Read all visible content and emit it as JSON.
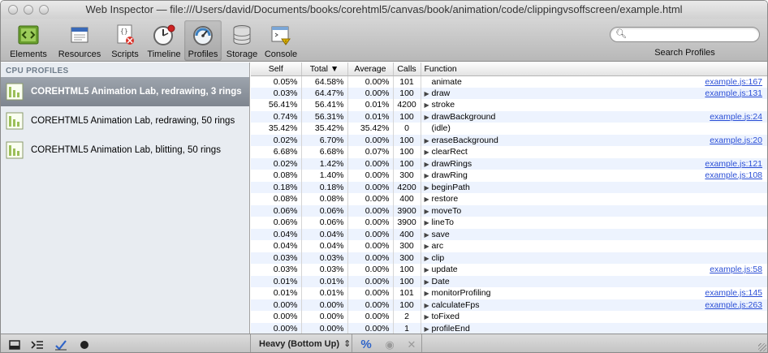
{
  "window": {
    "title": "Web Inspector — file:///Users/david/Documents/books/corehtml5/canvas/book/animation/code/clippingvsoffscreen/example.html"
  },
  "toolbar": {
    "items": [
      {
        "label": "Elements",
        "icon": "elements-icon"
      },
      {
        "label": "Resources",
        "icon": "resources-icon"
      },
      {
        "label": "Scripts",
        "icon": "scripts-icon"
      },
      {
        "label": "Timeline",
        "icon": "timeline-icon"
      },
      {
        "label": "Profiles",
        "icon": "profiles-icon",
        "selected": true
      },
      {
        "label": "Storage",
        "icon": "storage-icon"
      },
      {
        "label": "Console",
        "icon": "console-icon"
      }
    ],
    "search_value": "",
    "search_label": "Search Profiles"
  },
  "sidebar": {
    "header": "CPU PROFILES",
    "profiles": [
      {
        "label": "COREHTML5 Animation Lab, redrawing, 3 rings",
        "selected": true
      },
      {
        "label": "COREHTML5 Animation Lab, redrawing, 50 rings",
        "selected": false
      },
      {
        "label": "COREHTML5 Animation Lab, blitting, 50 rings",
        "selected": false
      }
    ]
  },
  "table": {
    "columns": {
      "self": "Self",
      "total": "Total ▼",
      "average": "Average",
      "calls": "Calls",
      "function": "Function"
    },
    "rows": [
      {
        "self": "0.05%",
        "total": "64.58%",
        "average": "0.00%",
        "calls": "101",
        "fn": "animate",
        "expand": false,
        "link": "example.js:167"
      },
      {
        "self": "0.03%",
        "total": "64.47%",
        "average": "0.00%",
        "calls": "100",
        "fn": "draw",
        "expand": true,
        "link": "example.js:131"
      },
      {
        "self": "56.41%",
        "total": "56.41%",
        "average": "0.01%",
        "calls": "4200",
        "fn": "stroke",
        "expand": true,
        "link": ""
      },
      {
        "self": "0.74%",
        "total": "56.31%",
        "average": "0.01%",
        "calls": "100",
        "fn": "drawBackground",
        "expand": true,
        "link": "example.js:24"
      },
      {
        "self": "35.42%",
        "total": "35.42%",
        "average": "35.42%",
        "calls": "0",
        "fn": "(idle)",
        "expand": false,
        "link": ""
      },
      {
        "self": "0.02%",
        "total": "6.70%",
        "average": "0.00%",
        "calls": "100",
        "fn": "eraseBackground",
        "expand": true,
        "link": "example.js:20"
      },
      {
        "self": "6.68%",
        "total": "6.68%",
        "average": "0.07%",
        "calls": "100",
        "fn": "clearRect",
        "expand": true,
        "link": ""
      },
      {
        "self": "0.02%",
        "total": "1.42%",
        "average": "0.00%",
        "calls": "100",
        "fn": "drawRings",
        "expand": true,
        "link": "example.js:121"
      },
      {
        "self": "0.08%",
        "total": "1.40%",
        "average": "0.00%",
        "calls": "300",
        "fn": "drawRing",
        "expand": true,
        "link": "example.js:108"
      },
      {
        "self": "0.18%",
        "total": "0.18%",
        "average": "0.00%",
        "calls": "4200",
        "fn": "beginPath",
        "expand": true,
        "link": ""
      },
      {
        "self": "0.08%",
        "total": "0.08%",
        "average": "0.00%",
        "calls": "400",
        "fn": "restore",
        "expand": true,
        "link": ""
      },
      {
        "self": "0.06%",
        "total": "0.06%",
        "average": "0.00%",
        "calls": "3900",
        "fn": "moveTo",
        "expand": true,
        "link": ""
      },
      {
        "self": "0.06%",
        "total": "0.06%",
        "average": "0.00%",
        "calls": "3900",
        "fn": "lineTo",
        "expand": true,
        "link": ""
      },
      {
        "self": "0.04%",
        "total": "0.04%",
        "average": "0.00%",
        "calls": "400",
        "fn": "save",
        "expand": true,
        "link": ""
      },
      {
        "self": "0.04%",
        "total": "0.04%",
        "average": "0.00%",
        "calls": "300",
        "fn": "arc",
        "expand": true,
        "link": ""
      },
      {
        "self": "0.03%",
        "total": "0.03%",
        "average": "0.00%",
        "calls": "300",
        "fn": "clip",
        "expand": true,
        "link": ""
      },
      {
        "self": "0.03%",
        "total": "0.03%",
        "average": "0.00%",
        "calls": "100",
        "fn": "update",
        "expand": true,
        "link": "example.js:58"
      },
      {
        "self": "0.01%",
        "total": "0.01%",
        "average": "0.00%",
        "calls": "100",
        "fn": "Date",
        "expand": true,
        "link": ""
      },
      {
        "self": "0.01%",
        "total": "0.01%",
        "average": "0.00%",
        "calls": "101",
        "fn": "monitorProfiling",
        "expand": true,
        "link": "example.js:145"
      },
      {
        "self": "0.00%",
        "total": "0.00%",
        "average": "0.00%",
        "calls": "100",
        "fn": "calculateFps",
        "expand": true,
        "link": "example.js:263"
      },
      {
        "self": "0.00%",
        "total": "0.00%",
        "average": "0.00%",
        "calls": "2",
        "fn": "toFixed",
        "expand": true,
        "link": ""
      },
      {
        "self": "0.00%",
        "total": "0.00%",
        "average": "0.00%",
        "calls": "1",
        "fn": "profileEnd",
        "expand": true,
        "link": ""
      }
    ]
  },
  "statusbar": {
    "view_mode": "Heavy (Bottom Up)",
    "stepper_glyph": "⇕",
    "percent_glyph": "%",
    "eye_glyph": "◉",
    "close_glyph": "✕",
    "dock_icon": "dock-icon",
    "console_icon": "console-toggle-icon",
    "check_icon": "checkmark-icon",
    "record_icon": "record-icon"
  },
  "colors": {
    "link": "#2b4fd6",
    "selected_profile": "#7e858f",
    "stripe": "#edf3fe",
    "sidebar_header": "#6e7c8a"
  }
}
